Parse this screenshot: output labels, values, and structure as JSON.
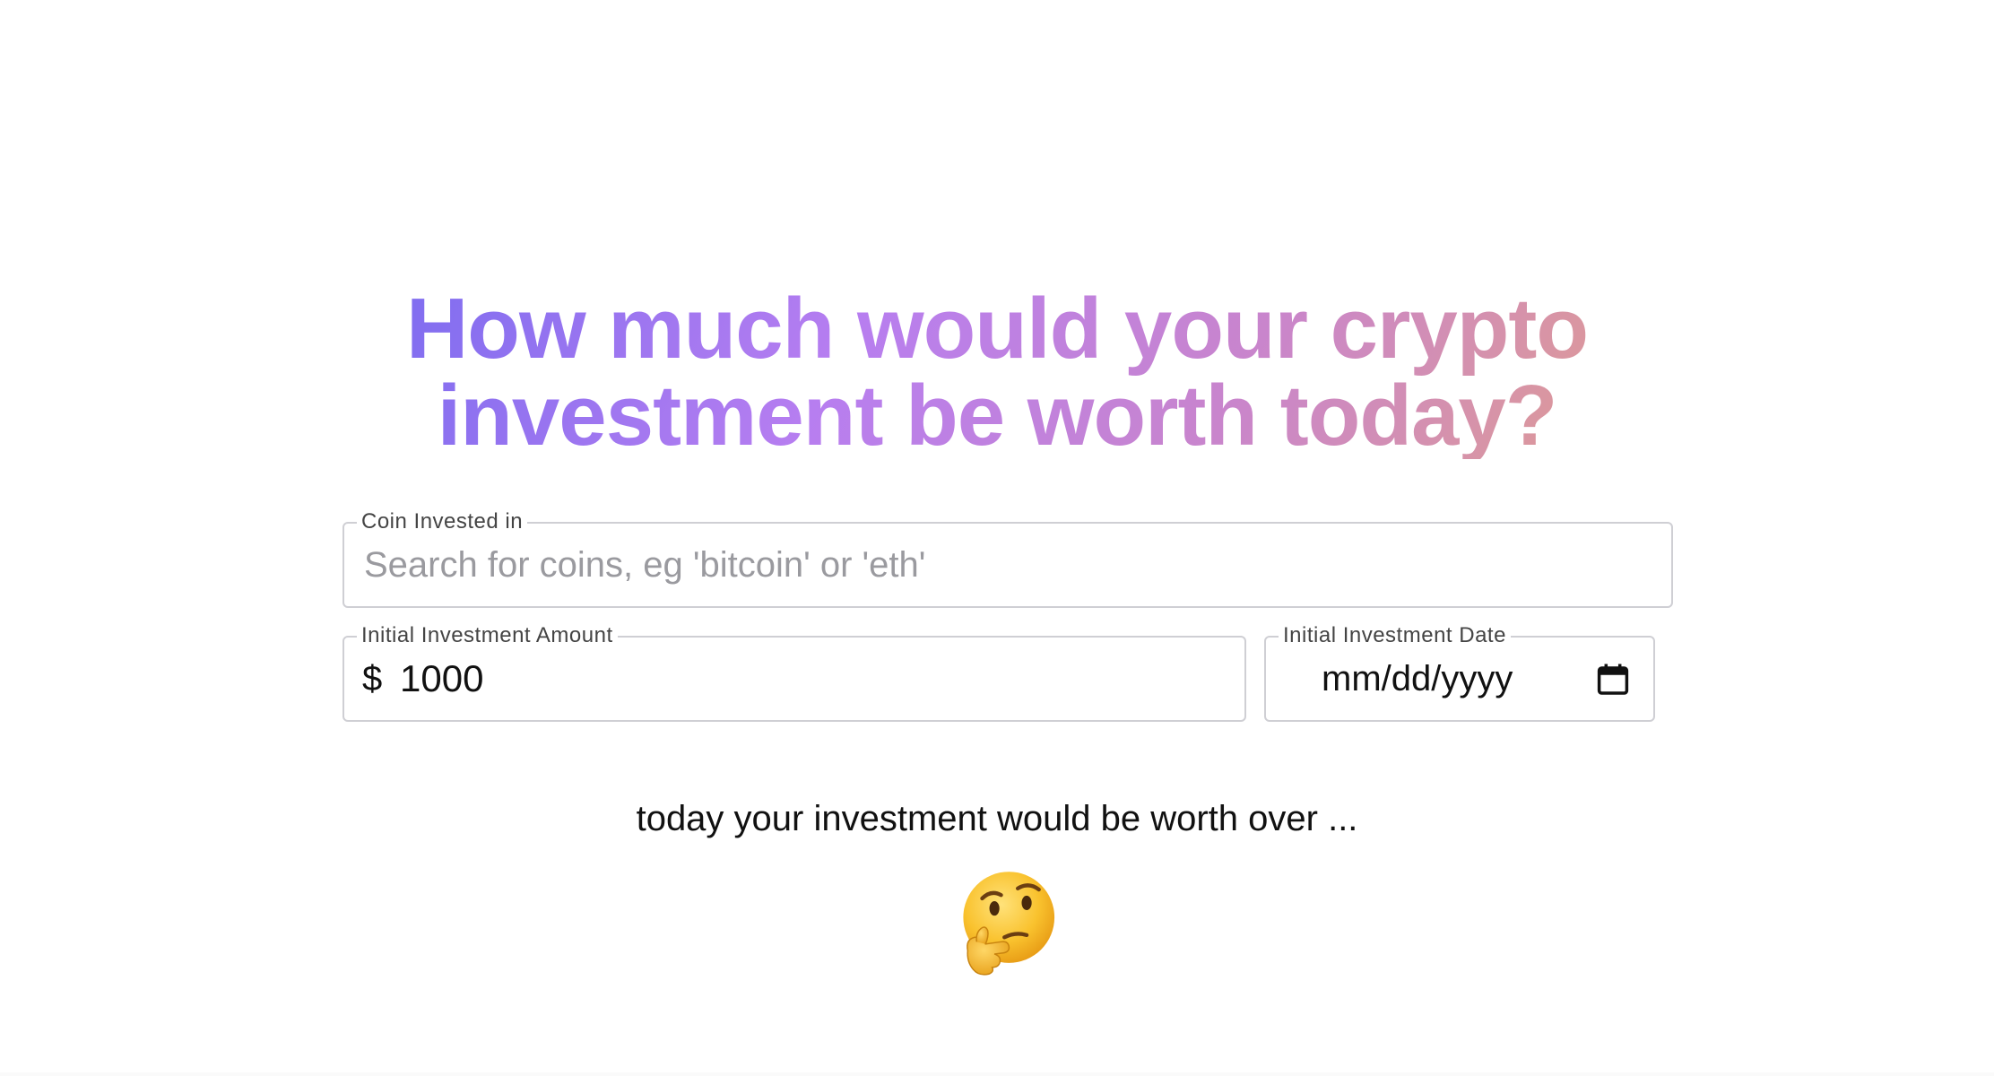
{
  "headline": {
    "line1": "How much would your crypto",
    "line2": "investment be worth today?"
  },
  "form": {
    "coin": {
      "label": "Coin Invested in",
      "value": "",
      "placeholder": "Search for coins, eg 'bitcoin' or 'eth'"
    },
    "amount": {
      "label": "Initial Investment Amount",
      "currency_symbol": "$",
      "value": "1000"
    },
    "date": {
      "label": "Initial Investment Date",
      "placeholder": "mm/dd/yyyy",
      "icon": "calendar-icon"
    }
  },
  "result": {
    "text": "today your investment would be worth over ...",
    "icon": "thinking-face-icon"
  },
  "colors": {
    "gradient_start": "#7c6cf0",
    "gradient_mid": "#c985cc",
    "gradient_end": "#e3a088",
    "field_border": "#cfcfd4"
  }
}
